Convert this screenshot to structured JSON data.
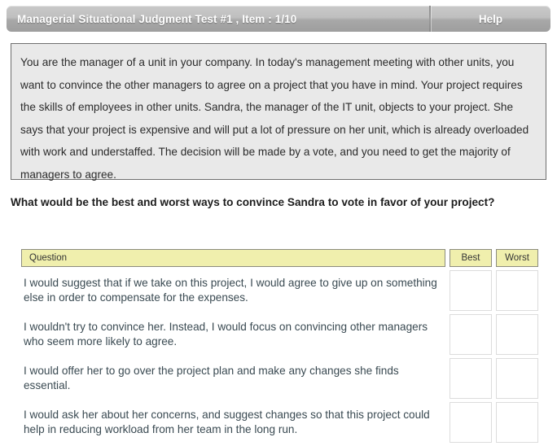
{
  "topbar": {
    "title": "Managerial Situational Judgment Test #1 , Item : 1/10",
    "help_label": "Help"
  },
  "scenario": {
    "text": "You are the manager of a unit in your company. In today's management meeting with other units, you want to convince the other managers to agree on a project that you have in mind. Your project requires the skills of employees in other units. Sandra, the manager of the IT unit, objects to your project. She says that your project is expensive and will put a lot of pressure on her unit, which is already overloaded with work and understaffed. The decision will be made by a vote, and you need to get the majority of managers to agree."
  },
  "prompt": {
    "text": "What would be the best and worst ways to convince Sandra to vote in favor of your project?"
  },
  "table": {
    "headers": {
      "question": "Question",
      "best": "Best",
      "worst": "Worst"
    },
    "rows": [
      {
        "text": "I would suggest that if we take on this project, I would agree to give up on something else in order to compensate for the expenses."
      },
      {
        "text": "I wouldn't try to convince her. Instead, I would focus on convincing other managers who seem more likely to agree."
      },
      {
        "text": "I would offer her to go over the project plan and make any changes she finds essential."
      },
      {
        "text": "I would ask her about her concerns, and suggest changes so that this project could help in reducing workload from her team in the long run."
      }
    ]
  },
  "colors": {
    "header_yellow": "#f0efad",
    "scenario_bg": "#e9e9e9",
    "bar_gray": "#bfbfbf",
    "answer_text": "#3a4a52"
  }
}
